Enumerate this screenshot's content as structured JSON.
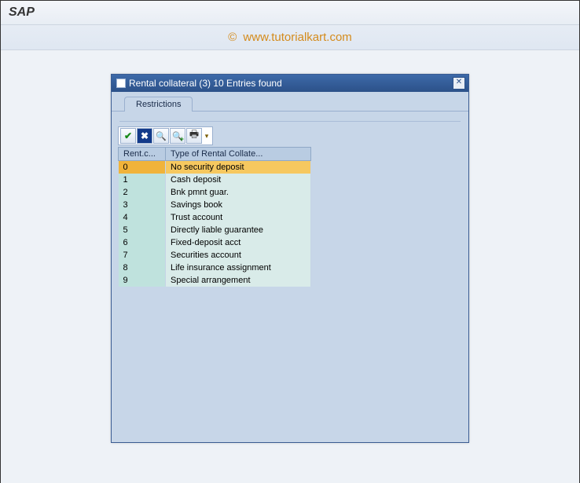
{
  "app": {
    "title": "SAP"
  },
  "watermark": {
    "copy": "©",
    "text": "www.tutorialkart.com"
  },
  "dialog": {
    "title": "Rental collateral (3)   10 Entries found",
    "close_glyph": "✕",
    "tabs": [
      {
        "label": "Restrictions"
      }
    ],
    "toolbar": {
      "check_glyph": "✔",
      "cancel_glyph": "✖",
      "find_glyph": "🔍",
      "findplus_glyph": "🔍",
      "print_glyph": "🖶",
      "drop_glyph": "▾"
    },
    "grid": {
      "columns": [
        "Rent.c...",
        "Type of Rental Collate..."
      ],
      "selected_index": 0,
      "rows": [
        {
          "code": "0",
          "desc": "No security deposit"
        },
        {
          "code": "1",
          "desc": "Cash deposit"
        },
        {
          "code": "2",
          "desc": "Bnk pmnt guar."
        },
        {
          "code": "3",
          "desc": "Savings book"
        },
        {
          "code": "4",
          "desc": "Trust account"
        },
        {
          "code": "5",
          "desc": "Directly liable guarantee"
        },
        {
          "code": "6",
          "desc": "Fixed-deposit acct"
        },
        {
          "code": "7",
          "desc": "Securities account"
        },
        {
          "code": "8",
          "desc": "Life insurance assignment"
        },
        {
          "code": "9",
          "desc": "Special arrangement"
        }
      ]
    }
  }
}
